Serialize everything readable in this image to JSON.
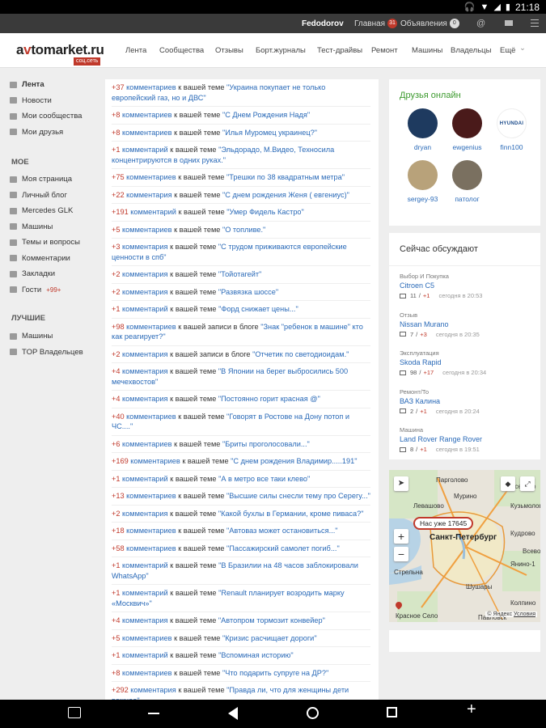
{
  "status_bar": {
    "time": "21:18"
  },
  "top_nav": {
    "username": "Fedodorov",
    "home_label": "Главная",
    "home_badge": "31",
    "ads_label": "Объявления",
    "ads_badge": "0",
    "at_symbol": "@"
  },
  "header": {
    "logo_a": "a",
    "logo_v": "v",
    "logo_rest": "tomarket.ru",
    "logo_sub": "соц.сеть",
    "nav": [
      "Лента",
      "Сообщества",
      "Отзывы",
      "Борт.журналы",
      "Тест-драйвы",
      "Ремонт",
      "Машины",
      "Владельцы",
      "Ещё"
    ]
  },
  "sidebar": {
    "main": [
      {
        "label": "Лента",
        "icon": "megaphone-icon"
      },
      {
        "label": "Новости",
        "icon": "newspaper-icon"
      },
      {
        "label": "Мои сообщества",
        "icon": "people-icon"
      },
      {
        "label": "Мои друзья",
        "icon": "person-icon"
      }
    ],
    "my_heading": "МОЕ",
    "my": [
      {
        "label": "Моя страница",
        "icon": "page-icon"
      },
      {
        "label": "Личный блог",
        "icon": "pen-icon"
      },
      {
        "label": "Mercedes GLK",
        "icon": "car-icon"
      },
      {
        "label": "Машины",
        "icon": "car-icon"
      },
      {
        "label": "Темы и вопросы",
        "icon": "chat-icon"
      },
      {
        "label": "Комментарии",
        "icon": "comment-icon"
      },
      {
        "label": "Закладки",
        "icon": "bookmark-icon"
      },
      {
        "label": "Гости",
        "icon": "guests-icon",
        "badge": "+99+"
      }
    ],
    "best_heading": "ЛУЧШИЕ",
    "best": [
      {
        "label": "Машины",
        "icon": "trophy-icon"
      },
      {
        "label": "TOP Владельцев",
        "icon": "chart-icon"
      }
    ]
  },
  "feed": [
    {
      "count": "+37",
      "word": "комментариев",
      "mid": "к вашей теме",
      "topic": "\"Украина покупает не только европейский газ, но и ДВС\""
    },
    {
      "count": "+8",
      "word": "комментариев",
      "mid": "к вашей теме",
      "topic": "\"С Днем Рождения Надя\""
    },
    {
      "count": "+8",
      "word": "комментариев",
      "mid": "к вашей теме",
      "topic": "\"Илья Муромец украинец?\""
    },
    {
      "count": "+1",
      "word": "комментарий",
      "mid": "к вашей теме",
      "topic": "\"Эльдорадо, М.Видео, Техносила концентрируются в одних руках.\""
    },
    {
      "count": "+75",
      "word": "комментариев",
      "mid": "к вашей теме",
      "topic": "\"Трешки по 38 квадратным метра\""
    },
    {
      "count": "+22",
      "word": "комментария",
      "mid": "к вашей теме",
      "topic": "\"С днем рождения Женя ( евгениус)\""
    },
    {
      "count": "+191",
      "word": "комментарий",
      "mid": "к вашей теме",
      "topic": "\"Умер Фидель Кастро\""
    },
    {
      "count": "+5",
      "word": "комментариев",
      "mid": "к вашей теме",
      "topic": "\"О топливе.\""
    },
    {
      "count": "+3",
      "word": "комментария",
      "mid": "к вашей теме",
      "topic": "\"С трудом приживаются европейские ценности в спб\""
    },
    {
      "count": "+2",
      "word": "комментария",
      "mid": "к вашей теме",
      "topic": "\"Тойотагейт\""
    },
    {
      "count": "+2",
      "word": "комментария",
      "mid": "к вашей теме",
      "topic": "\"Развязка шоссе\""
    },
    {
      "count": "+1",
      "word": "комментарий",
      "mid": "к вашей теме",
      "topic": "\"Форд снижает цены...\""
    },
    {
      "count": "+98",
      "word": "комментариев",
      "mid": "к вашей записи в блоге",
      "topic": "\"Знак \"ребенок в машине\" кто как реагирует?\""
    },
    {
      "count": "+2",
      "word": "комментария",
      "mid": "к вашей записи в блоге",
      "topic": "\"Отчетик по светодиоидам.\""
    },
    {
      "count": "+4",
      "word": "комментария",
      "mid": "к вашей теме",
      "topic": "\"В Японии на берег выбросились 500 мечехвостов\""
    },
    {
      "count": "+4",
      "word": "комментария",
      "mid": "к вашей теме",
      "topic": "\"Постоянно горит красная @\""
    },
    {
      "count": "+40",
      "word": "комментариев",
      "mid": "к вашей теме",
      "topic": "\"Говорят в Ростове на Дону потоп и ЧС....\""
    },
    {
      "count": "+6",
      "word": "комментариев",
      "mid": "к вашей теме",
      "topic": "\"Бриты проголосовали...\""
    },
    {
      "count": "+169",
      "word": "комментариев",
      "mid": "к вашей теме",
      "topic": "\"С днем рождения Владимир.....191\""
    },
    {
      "count": "+1",
      "word": "комментарий",
      "mid": "к вашей теме",
      "topic": "\"А в метро все таки клево\""
    },
    {
      "count": "+13",
      "word": "комментариев",
      "mid": "к вашей теме",
      "topic": "\"Высшие силы снесли тему про Серегу...\""
    },
    {
      "count": "+2",
      "word": "комментария",
      "mid": "к вашей теме",
      "topic": "\"Какой бухлы в Германии, кроме пиваса?\""
    },
    {
      "count": "+18",
      "word": "комментариев",
      "mid": "к вашей теме",
      "topic": "\"Автоваз может остановиться...\""
    },
    {
      "count": "+58",
      "word": "комментариев",
      "mid": "к вашей теме",
      "topic": "\"Пассажирский самолет погиб...\""
    },
    {
      "count": "+1",
      "word": "комментарий",
      "mid": "к вашей теме",
      "topic": "\"В Бразилии на 48 часов заблокировали WhatsApp\""
    },
    {
      "count": "+1",
      "word": "комментарий",
      "mid": "к вашей теме",
      "topic": "\"Renault планирует возродить марку «Москвич»\""
    },
    {
      "count": "+4",
      "word": "комментария",
      "mid": "к вашей теме",
      "topic": "\"Автопром тормозит конвейер\""
    },
    {
      "count": "+5",
      "word": "комментариев",
      "mid": "к вашей теме",
      "topic": "\"Кризис расчищает дороги\""
    },
    {
      "count": "+1",
      "word": "комментарий",
      "mid": "к вашей теме",
      "topic": "\"Вспоминая историю\""
    },
    {
      "count": "+8",
      "word": "комментариев",
      "mid": "к вашей теме",
      "topic": "\"Что подарить супруге на ДР?\""
    },
    {
      "count": "+292",
      "word": "комментария",
      "mid": "к вашей теме",
      "topic": "\"Правда ли, что для женщины дети важнее\""
    }
  ],
  "friends": {
    "title": "Друзья онлайн",
    "items": [
      {
        "name": "dryan",
        "color": "#1e3a5f"
      },
      {
        "name": "ewgenius",
        "color": "#4a1a1a"
      },
      {
        "name": "finn100",
        "color": "#ffffff",
        "logo_text": "HYUNDAI"
      },
      {
        "name": "sergey-93",
        "color": "#b8a27a"
      },
      {
        "name": "патолог",
        "color": "#7a7060"
      }
    ]
  },
  "discuss": {
    "title": "Сейчас обсуждают",
    "items": [
      {
        "category": "Выбор И Покупка",
        "title": "Citroen C5",
        "total": "11",
        "new": "+1",
        "date": "сегодня в 20:53"
      },
      {
        "category": "Отзыв",
        "title": "Nissan Murano",
        "total": "7",
        "new": "+3",
        "date": "сегодня в 20:35"
      },
      {
        "category": "Эксплуатация",
        "title": "Skoda Rapid",
        "total": "98",
        "new": "+17",
        "date": "сегодня в 20:34"
      },
      {
        "category": "Ремонт/То",
        "title": "ВАЗ Калина",
        "total": "2",
        "new": "+1",
        "date": "сегодня в 20:24"
      },
      {
        "category": "Машина",
        "title": "Land Rover Range Rover",
        "total": "8",
        "new": "+1",
        "date": "сегодня в 19:51"
      }
    ]
  },
  "map": {
    "bubble": "Нас уже 17645",
    "city": "Санкт-Петербург",
    "labels": [
      "Парголово",
      "Всеволо",
      "Мурино",
      "Кузьмолово",
      "Кудрово",
      "Всево",
      "Янино-1",
      "Стрельна",
      "Шушары",
      "Красное Село",
      "Колпино",
      "Павловск",
      "Левашово"
    ],
    "zoom_in": "+",
    "zoom_out": "−",
    "attribution": "© Яндекс",
    "terms": "Условия"
  }
}
